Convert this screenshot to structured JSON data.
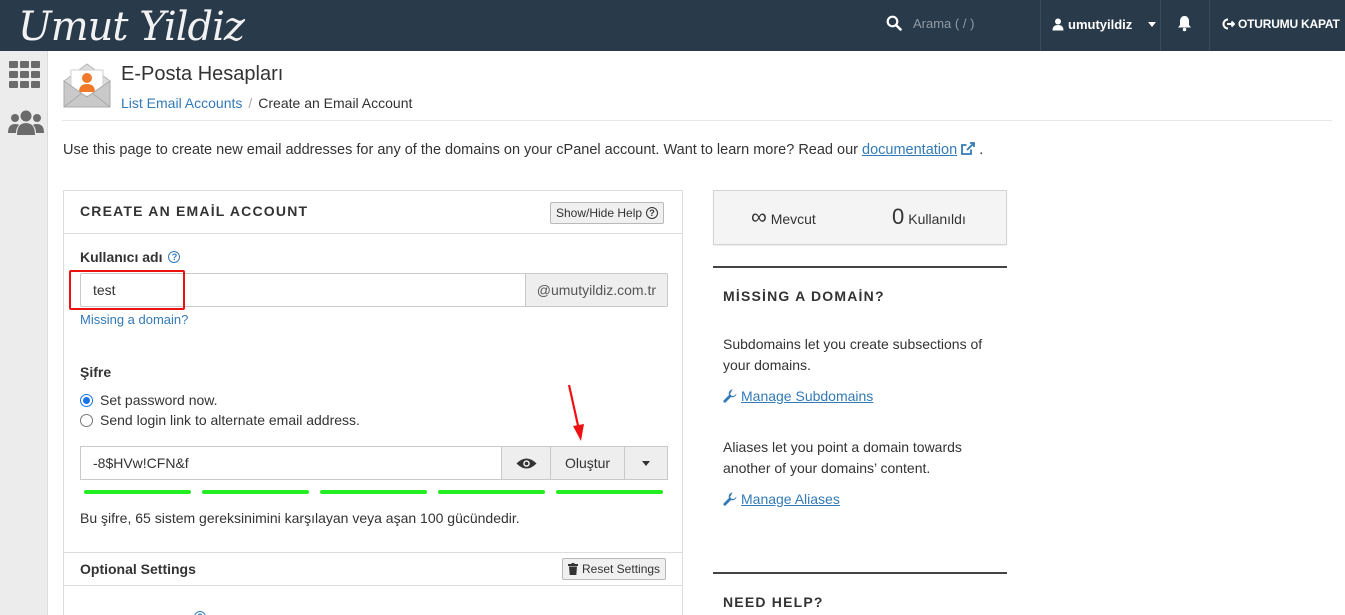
{
  "topbar": {
    "logo_text": "Umut Yildiz",
    "search_placeholder": "Arama ( / )",
    "username": "umutyildiz",
    "logout_label": "OTURUMU KAPAT"
  },
  "header": {
    "title": "E-Posta Hesapları",
    "breadcrumb": [
      "List Email Accounts",
      "Create an Email Account"
    ]
  },
  "intro": {
    "text": "Use this page to create new email addresses for any of the domains on your cPanel account. Want to learn more? Read our ",
    "link": "documentation",
    "end": "."
  },
  "form": {
    "panel_title": "CREATE AN EMAİL ACCOUNT",
    "help_button": "Show/Hide Help",
    "username_label": "Kullanıcı adı",
    "username_value": "test",
    "domain_suffix": "@umutyildiz.com.tr",
    "missing_domain_link": "Missing a domain?",
    "password_label": "Şifre",
    "radio_options": [
      "Set password now.",
      "Send login link to alternate email address."
    ],
    "radio_selected": 0,
    "password_value": "-8$HVw!CFN&f",
    "generate_label": "Oluştur",
    "strength_text": "Bu şifre, 65 sistem gereksinimini karşılayan veya aşan 100 gücündedir.",
    "strength_value": 100,
    "optional_title": "Optional Settings",
    "reset_button": "Reset Settings"
  },
  "stats": {
    "available_symbol": "∞",
    "available_label": "Mevcut",
    "used_value": "0",
    "used_label": "Kullanıldı"
  },
  "sidebar_right": {
    "missing_title": "MİSSİNG A DOMAİN?",
    "subdomains_text": "Subdomains let you create subsections of your domains.",
    "subdomains_link": "Manage Subdomains",
    "aliases_text": "Aliases let you point a domain towards another of your domains’ content.",
    "aliases_link": "Manage Aliases",
    "help_title": "NEED HELP?"
  },
  "colors": {
    "topbar": "#293a4a",
    "link": "#337ab7",
    "strength_bar": "#22ee22",
    "annotation": "#ee1111"
  }
}
